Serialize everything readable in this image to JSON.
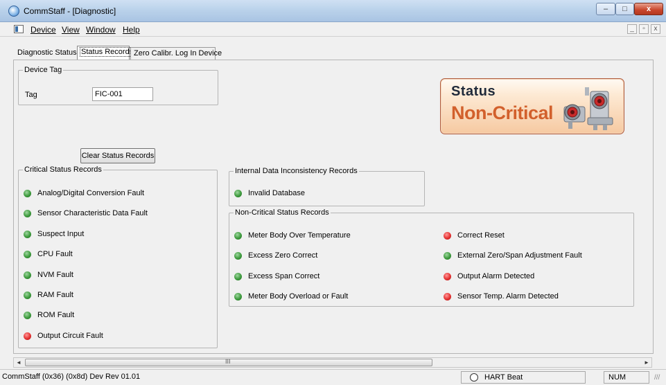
{
  "window": {
    "title": "CommStaff - [Diagnostic]",
    "minimize": "–",
    "maximize": "□",
    "close": "x"
  },
  "menu": [
    "Device",
    "View",
    "Window",
    "Help"
  ],
  "mdi_controls": {
    "minimize": "_",
    "restore": "ฅ",
    "close": "x"
  },
  "tabs": [
    "Diagnostic Status",
    "Status Records",
    "Zero Calibr. Log In Device"
  ],
  "active_tab": "Status Records",
  "device_tag": {
    "legend": "Device Tag",
    "label": "Tag",
    "value": "FIC-001"
  },
  "status_panel": {
    "word": "Status",
    "value": "Non-Critical"
  },
  "clear_button": "Clear Status Records",
  "critical": {
    "legend": "Critical Status Records",
    "items": [
      {
        "label": "Analog/Digital Conversion Fault",
        "state": "green"
      },
      {
        "label": "Sensor Characteristic Data Fault",
        "state": "green"
      },
      {
        "label": "Suspect Input",
        "state": "green"
      },
      {
        "label": "CPU Fault",
        "state": "green"
      },
      {
        "label": "NVM Fault",
        "state": "green"
      },
      {
        "label": "RAM Fault",
        "state": "green"
      },
      {
        "label": "ROM Fault",
        "state": "green"
      },
      {
        "label": "Output Circuit Fault",
        "state": "red"
      }
    ]
  },
  "internal": {
    "legend": "Internal Data Inconsistency Records",
    "items": [
      {
        "label": "Invalid Database",
        "state": "green"
      }
    ]
  },
  "non_critical": {
    "legend": "Non-Critical Status Records",
    "left": [
      {
        "label": "Meter Body Over Temperature",
        "state": "green"
      },
      {
        "label": "Excess Zero Correct",
        "state": "green"
      },
      {
        "label": "Excess Span Correct",
        "state": "green"
      },
      {
        "label": "Meter Body Overload or Fault",
        "state": "green"
      }
    ],
    "right": [
      {
        "label": "Correct Reset",
        "state": "red"
      },
      {
        "label": "External Zero/Span Adjustment Fault",
        "state": "green"
      },
      {
        "label": "Output Alarm Detected",
        "state": "red"
      },
      {
        "label": "Sensor Temp. Alarm Detected",
        "state": "red"
      }
    ]
  },
  "scrollbar": {
    "left": "◄",
    "right": "►",
    "grip": "III"
  },
  "statusbar": {
    "text": "CommStaff  (0x36)  (0x8d)  Dev Rev 01.01",
    "hart": "HART Beat",
    "num": "NUM",
    "grip": "///"
  },
  "colors": {
    "green": "#3d9a3d",
    "red": "#e53131",
    "status_accent": "#d2602c"
  }
}
